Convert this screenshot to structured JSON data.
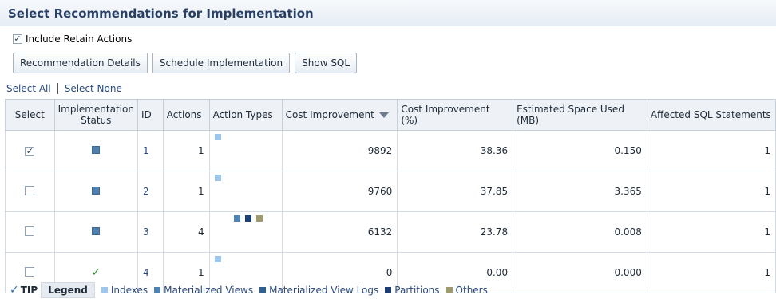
{
  "page_title": "Select Recommendations for Implementation",
  "retain": {
    "label": "Include Retain Actions",
    "checked": true
  },
  "buttons": {
    "details": "Recommendation Details",
    "schedule": "Schedule Implementation",
    "show_sql": "Show SQL"
  },
  "select_links": {
    "all": "Select All",
    "none": "Select None"
  },
  "columns": {
    "select": "Select",
    "status": "Implementation Status",
    "id": "ID",
    "actions": "Actions",
    "action_types": "Action Types",
    "cost": "Cost Improvement",
    "cost_pct": "Cost Improvement (%)",
    "space": "Estimated Space Used (MB)",
    "affected": "Affected SQL Statements"
  },
  "rows": [
    {
      "selected": true,
      "status": "square",
      "id": "1",
      "actions": "1",
      "types": [
        "indexes"
      ],
      "cost": "9892",
      "cost_pct": "38.36",
      "space": "0.150",
      "affected": "1"
    },
    {
      "selected": false,
      "status": "square",
      "id": "2",
      "actions": "1",
      "types": [
        "indexes"
      ],
      "cost": "9760",
      "cost_pct": "37.85",
      "space": "3.365",
      "affected": "1"
    },
    {
      "selected": false,
      "status": "square",
      "id": "3",
      "actions": "4",
      "types": [
        "mat_views",
        "partitions",
        "others"
      ],
      "cost": "6132",
      "cost_pct": "23.78",
      "space": "0.008",
      "affected": "1"
    },
    {
      "selected": false,
      "status": "check",
      "id": "4",
      "actions": "1",
      "types": [
        "indexes"
      ],
      "cost": "0",
      "cost_pct": "0.00",
      "space": "0.000",
      "affected": "1"
    }
  ],
  "legend": {
    "tip": "TIP",
    "label": "Legend",
    "items": [
      {
        "key": "indexes",
        "label": "Indexes",
        "color": "#9cc7ef"
      },
      {
        "key": "mat_views",
        "label": "Materialized Views",
        "color": "#4f82b5"
      },
      {
        "key": "mv_logs",
        "label": "Materialized View Logs",
        "color": "#2f5f97"
      },
      {
        "key": "partitions",
        "label": "Partitions",
        "color": "#1d3e73"
      },
      {
        "key": "others",
        "label": "Others",
        "color": "#9f9a6c"
      }
    ]
  }
}
